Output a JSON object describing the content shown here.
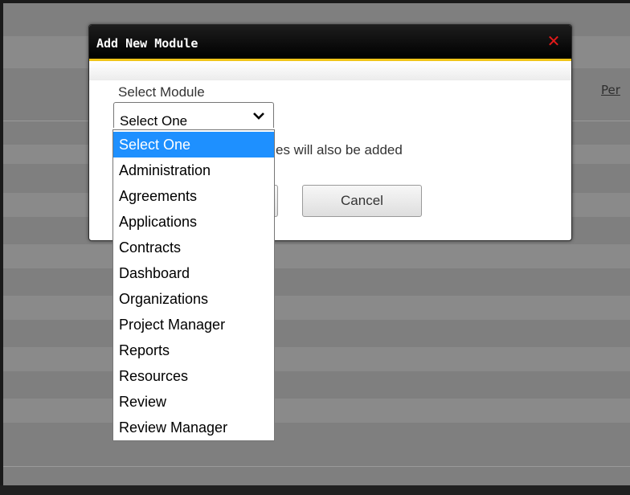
{
  "background": {
    "link_text": "Per"
  },
  "modal": {
    "title": "Add New Module",
    "close_symbol": "✕",
    "field_label": "Select Module",
    "select": {
      "value": "Select One",
      "options": [
        "Select One",
        "Administration",
        "Agreements",
        "Applications",
        "Contracts",
        "Dashboard",
        "Organizations",
        "Project Manager",
        "Reports",
        "Resources",
        "Review",
        "Review Manager"
      ],
      "highlighted_index": 0
    },
    "note": "es will also be added",
    "buttons": {
      "cancel_label": "Cancel"
    }
  },
  "colors": {
    "header_bg": "#000000",
    "header_accent": "#f0c419",
    "close_icon": "#e21a1a",
    "selection": "#1e90ff",
    "backdrop": "#7f7f7f"
  }
}
